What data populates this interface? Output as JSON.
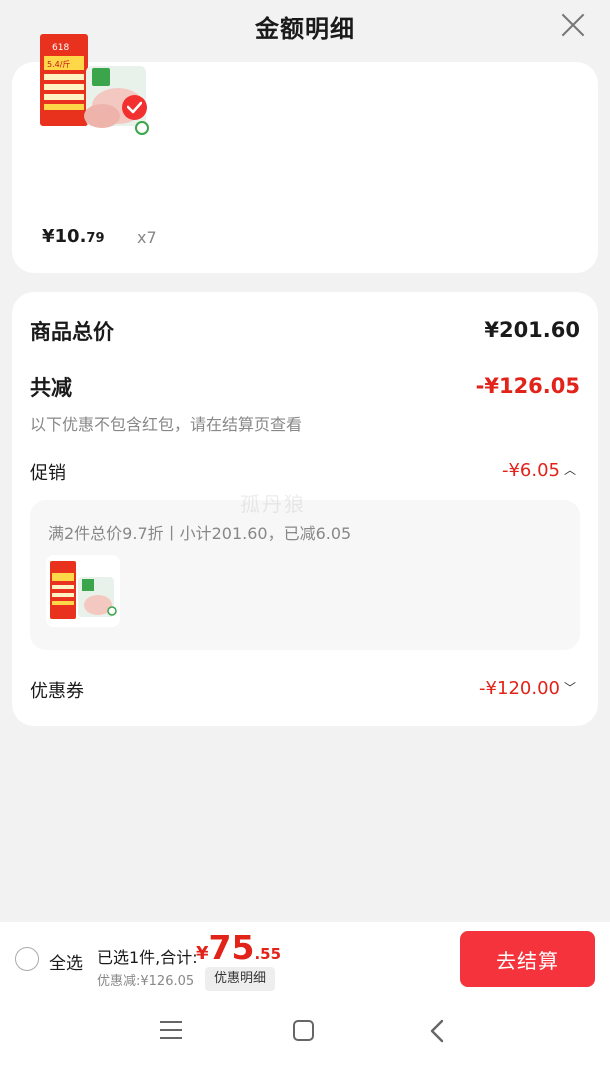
{
  "header": {
    "title": "金额明细"
  },
  "product": {
    "price_int": "¥10.",
    "price_dec": "79",
    "quantity": "x7",
    "thumbnail": {
      "tag_top": "618",
      "price_tag": "5.4/斤",
      "icon": "chicken-breast-package-image"
    }
  },
  "detail": {
    "total_label": "商品总价",
    "total_value": "¥201.60",
    "reduce_label": "共减",
    "reduce_value": "-¥126.05",
    "note": "以下优惠不包含红包，请在结算页查看",
    "promo_label": "促销",
    "promo_value": "-¥6.05",
    "promo_desc": "满2件总价9.7折丨小计201.60，已减6.05",
    "coupon_label": "优惠券",
    "coupon_value": "-¥120.00"
  },
  "watermark": "孤丹狼",
  "bottom_bar": {
    "select_all": "全选",
    "summary_prefix": "已选1件,合计:",
    "amount_yen": "¥",
    "amount_int": "75",
    "amount_dec": ".55",
    "discount": "优惠减:¥126.05",
    "detail_chip": "优惠明细",
    "checkout": "去结算"
  },
  "colors": {
    "accent": "#e2231a",
    "checkout_bg": "#f4333c",
    "page_bg": "#f2f2f2"
  }
}
